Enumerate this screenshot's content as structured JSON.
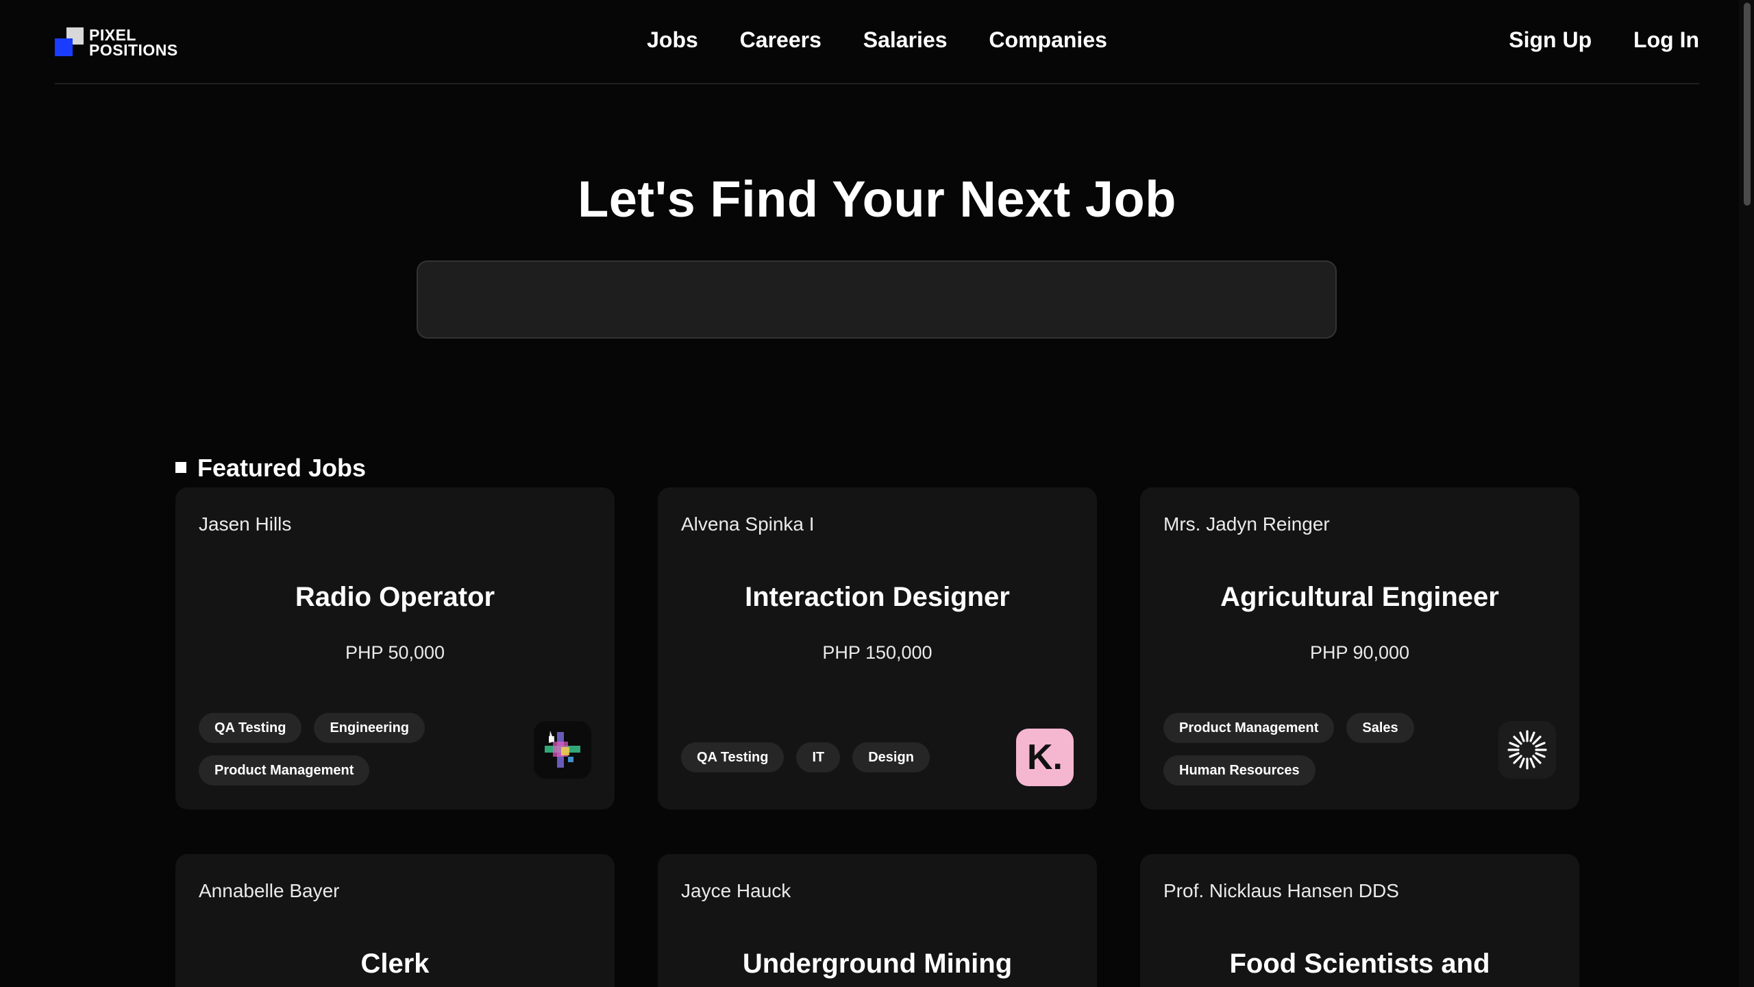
{
  "brand": {
    "line1": "PIXEL",
    "line2": "POSITIONS",
    "colors": {
      "blue": "#1a3cff",
      "grey": "#d8d8d8"
    }
  },
  "nav": {
    "links": [
      "Jobs",
      "Careers",
      "Salaries",
      "Companies"
    ],
    "sign_up": "Sign Up",
    "log_in": "Log In"
  },
  "hero": {
    "title": "Let's Find Your Next Job",
    "search": {
      "value": "",
      "placeholder": ""
    }
  },
  "featured": {
    "heading": "Featured Jobs",
    "jobs": [
      {
        "employer": "Jasen Hills",
        "title": "Radio Operator",
        "salary": "PHP 50,000",
        "tags": [
          "QA Testing",
          "Engineering",
          "Product Management"
        ],
        "logo": "colorful-glitch-logo-icon"
      },
      {
        "employer": "Alvena Spinka I",
        "title": "Interaction Designer",
        "salary": "PHP 150,000",
        "tags": [
          "QA Testing",
          "IT",
          "Design"
        ],
        "logo": "klarna-k-logo-icon",
        "logo_text": "K."
      },
      {
        "employer": "Mrs. Jadyn Reinger",
        "title": "Agricultural Engineer",
        "salary": "PHP 90,000",
        "tags": [
          "Product Management",
          "Sales",
          "Human Resources"
        ],
        "logo": "sunburst-logo-icon"
      },
      {
        "employer": "Annabelle Bayer",
        "title": "Clerk"
      },
      {
        "employer": "Jayce Hauck",
        "title": "Underground Mining"
      },
      {
        "employer": "Prof. Nicklaus Hansen DDS",
        "title": "Food Scientists and"
      }
    ]
  }
}
